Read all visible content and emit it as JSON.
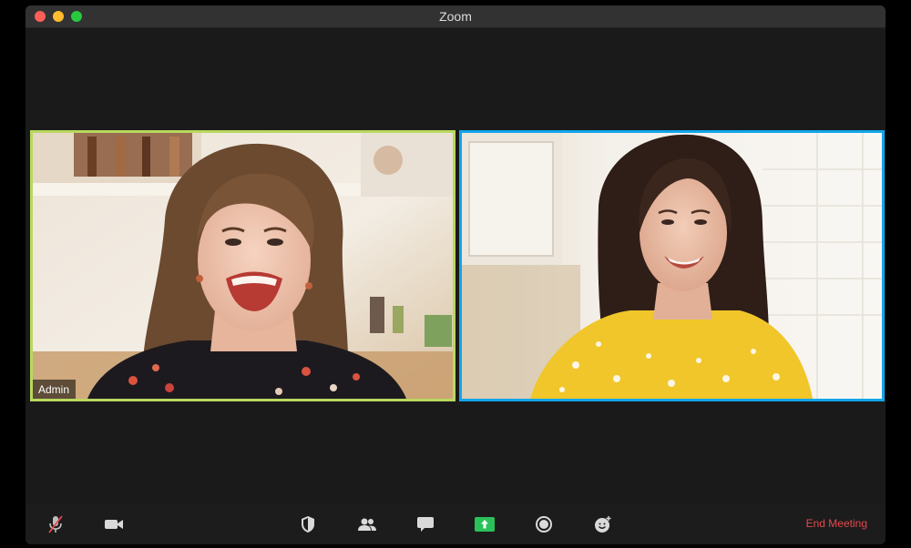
{
  "window": {
    "title": "Zoom",
    "buttons": [
      "close",
      "minimize",
      "maximize"
    ]
  },
  "participants": [
    {
      "name": "Admin",
      "border_color": "#b9d860",
      "role": "active-speaker-left"
    },
    {
      "name": "",
      "border_color": "#12a5ea",
      "role": "pinned-right"
    }
  ],
  "toolbar": {
    "icons": [
      "microphone-muted-icon",
      "video-camera-icon",
      "security-shield-icon",
      "participants-icon",
      "chat-icon",
      "share-screen-icon",
      "record-icon",
      "reactions-icon"
    ],
    "end_meeting_label": "End Meeting",
    "share_color": "#2ac15a",
    "end_color": "#e5484d"
  }
}
